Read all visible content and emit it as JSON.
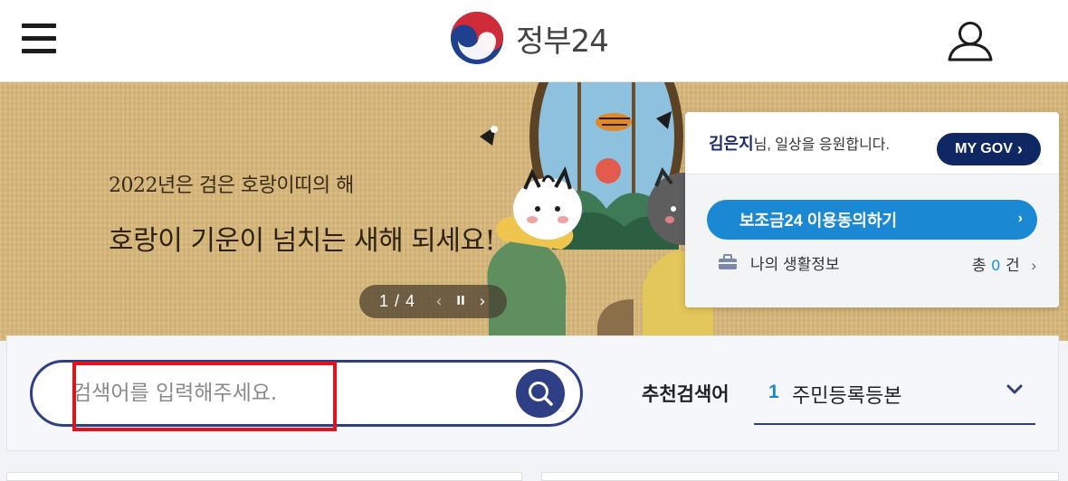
{
  "header": {
    "logo_text": "정부24",
    "menu_icon": "hamburger-menu-icon",
    "user_icon": "user-profile-icon"
  },
  "banner": {
    "line1": "2022년은 검은 호랑이띠의 해",
    "line2": "호랑이 기운이 넘치는 새해 되세요!",
    "slider": {
      "count": "1 / 4",
      "prev": "‹",
      "pause": "II",
      "next": "›"
    }
  },
  "user_card": {
    "name": "김은지",
    "greeting": "님, 일상을 응원합니다.",
    "mygov_label": "MY GOV",
    "mygov_chevron": "›",
    "subsidy_label": "보조금24 이용동의하기",
    "subsidy_chevron": "›",
    "life_info_label": "나의 생활정보",
    "life_count_prefix": "총",
    "life_count_value": "0",
    "life_count_suffix": "건",
    "life_chevron": "›"
  },
  "search": {
    "placeholder": "검색어를 입력해주세요.",
    "value": "",
    "recommended_label": "추천검색어",
    "recommended_rank": "1",
    "recommended_term": "주민등록등본"
  },
  "colors": {
    "brand_navy": "#2e3f86",
    "mygov_navy": "#0f2863",
    "accent_blue": "#1b88d4",
    "banner_bg": "#d9b97b",
    "highlight_red": "#e2141a"
  }
}
